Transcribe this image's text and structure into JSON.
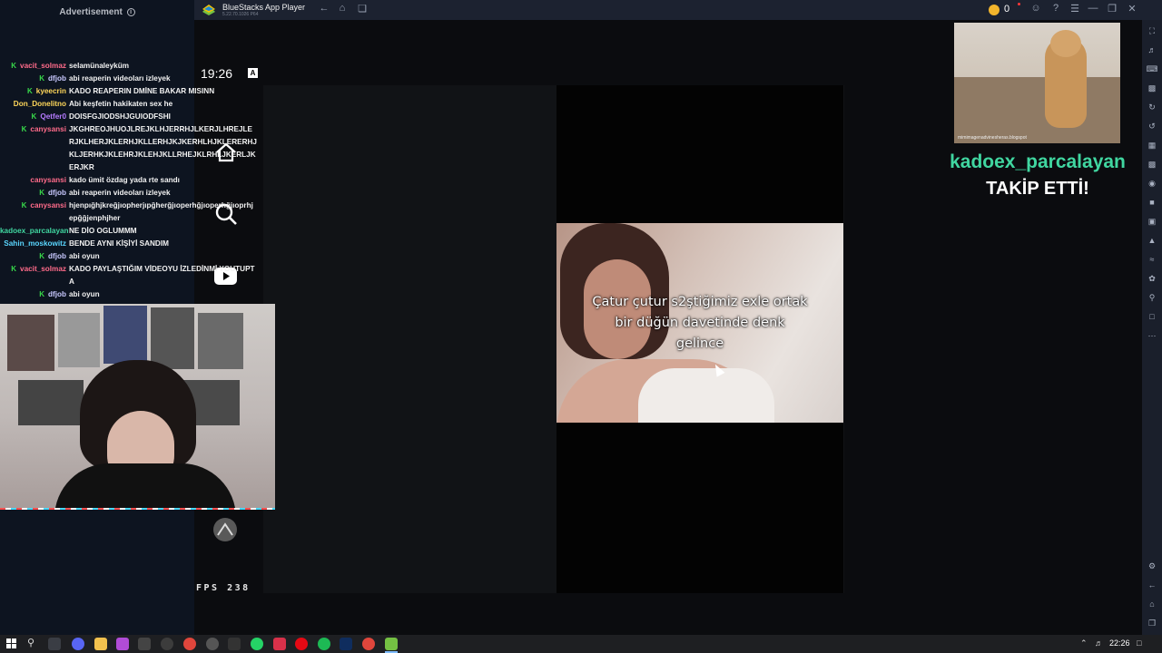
{
  "chat": {
    "ad_label": "Advertisement",
    "messages": [
      {
        "user": "vacit_solmaz",
        "user_color": "#ff6b8a",
        "badge": true,
        "text": "selamünaleyküm"
      },
      {
        "user": "dfjob",
        "user_color": "#c9c9ff",
        "badge": true,
        "text": "abi reaperin videoları izleyek"
      },
      {
        "user": "kyeecrin",
        "user_color": "#ffd75a",
        "badge": true,
        "text": "KADO REAPERIN DMİNE BAKAR MISINN"
      },
      {
        "user": "Don_Donelitno",
        "user_color": "#ffd75a",
        "badge": false,
        "text": "Abi keşfetin hakikaten sex he"
      },
      {
        "user": "Qetfer0",
        "user_color": "#b57bff",
        "badge": true,
        "text": "DOISFGJIODSHJGUIODFSHI"
      },
      {
        "user": "canysansi",
        "user_color": "#ff6b8a",
        "badge": true,
        "text": "JKGHREOJHUOJLREJKLHJERRHJLKERJLHREJLERJKLHERJKLERHJKLLERHJKJKERHLHJKLERERHJKLJERHKJKLEHRJKLEHJKLLRHEJKLRHLJKERLJKERJKR"
      },
      {
        "user": "canysansi",
        "user_color": "#ff6b8a",
        "badge": false,
        "text": "kado ümit özdag yada rte sandı"
      },
      {
        "user": "dfjob",
        "user_color": "#c9c9ff",
        "badge": true,
        "text": "abi reaperin videoları izleyek"
      },
      {
        "user": "canysansi",
        "user_color": "#ff6b8a",
        "badge": true,
        "text": "hjenpığhjkreğjıopherjıpğherğjıoperhğjıoperhğjıoprhjepğğjenphjher"
      },
      {
        "user": "kadoex_parcalayan",
        "user_color": "#40d6a0",
        "badge": false,
        "text": "NE DİO OGLUMMM"
      },
      {
        "user": "Sahin_moskowitz",
        "user_color": "#5ad6ff",
        "badge": false,
        "text": "BENDE AYNI KİŞİYİ SANDIM"
      },
      {
        "user": "dfjob",
        "user_color": "#c9c9ff",
        "badge": true,
        "text": "abi oyun"
      },
      {
        "user": "vacit_solmaz",
        "user_color": "#ff6b8a",
        "badge": true,
        "text": "KADO PAYLAŞTIĞIM VİDEOYU İZLEDİNMİ YOUTUPTA"
      },
      {
        "user": "dfjob",
        "user_color": "#c9c9ff",
        "badge": true,
        "text": "abi oyun"
      }
    ]
  },
  "emulator": {
    "title": "BlueStacks App Player",
    "version": "5.22.70.1026 P64",
    "coins": "0"
  },
  "phone": {
    "time": "19:26",
    "fps_label": "FPS 238"
  },
  "video": {
    "caption_lines": [
      "Çatur çutur s2ştiğimiz exle ortak",
      "bir düğün davetinde  denk",
      "gelince"
    ]
  },
  "alert": {
    "username": "kadoex_parcalayan",
    "action": "TAKİP ETTİ!",
    "watermark": "mimimagenadvinesheras.blogspot"
  },
  "taskbar": {
    "clock": "22:26"
  },
  "colors": {
    "alert_accent": "#40d6a0",
    "badge_green": "#38d94a",
    "chat_bg": "#0d1420"
  }
}
